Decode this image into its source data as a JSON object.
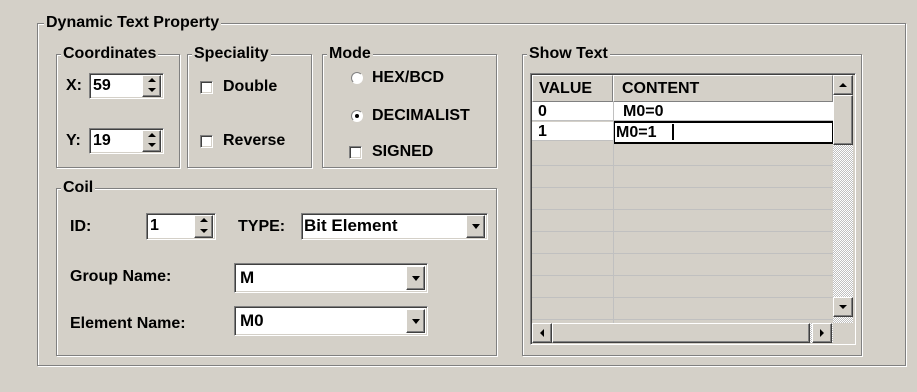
{
  "dynamic_text_property": {
    "title": "Dynamic Text Property",
    "coordinates": {
      "title": "Coordinates",
      "x_label": "X:",
      "x_value": "59",
      "y_label": "Y:",
      "y_value": "19"
    },
    "speciality": {
      "title": "Speciality",
      "double_label": "Double",
      "double_checked": false,
      "reverse_label": "Reverse",
      "reverse_checked": false
    },
    "mode": {
      "title": "Mode",
      "hex_label": "HEX/BCD",
      "decimalist_label": "DECIMALIST",
      "selected": "DECIMALIST",
      "signed_label": "SIGNED",
      "signed_checked": false
    },
    "coil": {
      "title": "Coil",
      "id_label": "ID:",
      "id_value": "1",
      "type_label": "TYPE:",
      "type_value": "Bit Element",
      "group_name_label": "Group Name:",
      "group_name_value": "M",
      "element_name_label": "Element Name:",
      "element_name_value": "M0"
    },
    "show_text": {
      "title": "Show Text",
      "columns": [
        "VALUE",
        "CONTENT"
      ],
      "rows": [
        {
          "value": "0",
          "content": "M0=0"
        },
        {
          "value": "1",
          "content": "M0=1"
        }
      ]
    }
  }
}
